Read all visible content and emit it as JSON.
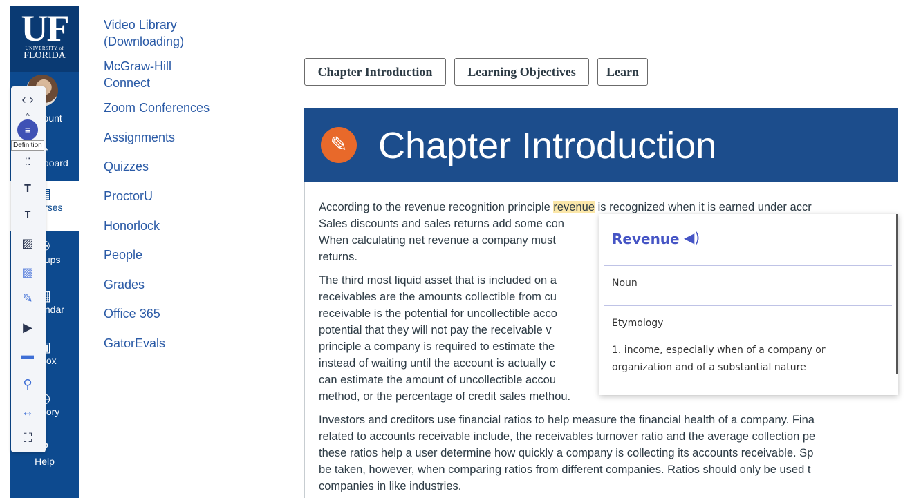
{
  "global_nav": {
    "logo": {
      "uf": "UF",
      "university": "UNIVERSITY of",
      "florida": "FLORIDA"
    },
    "items": [
      {
        "label": "Account",
        "icon": "avatar"
      },
      {
        "label": "Dashboard",
        "icon": "dashboard-icon"
      },
      {
        "label": "Courses",
        "icon": "courses-icon"
      },
      {
        "label": "Groups",
        "icon": "groups-icon"
      },
      {
        "label": "Calendar",
        "icon": "calendar-icon"
      },
      {
        "label": "Inbox",
        "icon": "inbox-icon"
      },
      {
        "label": "History",
        "icon": "history-icon"
      },
      {
        "label": "Help",
        "icon": "help-icon"
      }
    ]
  },
  "course_nav": {
    "items": [
      "Video Library (Downloading)",
      "McGraw-Hill Connect",
      "Zoom Conferences",
      "Assignments",
      "Quizzes",
      "ProctorU",
      "Honorlock",
      "People",
      "Grades",
      "Office 365",
      "GatorEvals"
    ]
  },
  "toolbar": {
    "tooltip": "Definition",
    "buttons": [
      "prev-next-icon",
      "collapse-icon",
      "definition-icon",
      "toggle-icon",
      "text-size-icon",
      "text-small-icon",
      "clipboard-icon",
      "image-icon",
      "edit-icon",
      "play-icon",
      "mask-icon",
      "search-icon",
      "spacing-icon",
      "fullscreen-icon"
    ]
  },
  "tabs": [
    {
      "label": "Chapter Introduction"
    },
    {
      "label": "Learning Objectives"
    },
    {
      "label": "Learn"
    }
  ],
  "banner": {
    "title": "Chapter Introduction",
    "icon": "tag-icon"
  },
  "content": {
    "p1": [
      {
        "before": "According to the revenue recognition principle ",
        "highlight": "revenue",
        "after": " is recognized when it is earned under accr"
      },
      "Sales discounts and sales returns add some con",
      "When calculating net revenue a company must",
      "returns."
    ],
    "p2": [
      "The third most liquid asset that is included on a",
      "receivables are the amounts collectible from cu",
      "receivable is the potential for uncollectible acco",
      "potential that they will not pay the receivable v",
      "principle a company is required to estimate the",
      "instead of waiting until the account is actually c",
      "can estimate the amount of uncollectible accou",
      "method, or the percentage of credit sales methou."
    ],
    "p3": [
      "Investors and creditors use financial ratios to help measure the financial health of a company. Fina",
      "related to accounts receivable include, the receivables turnover ratio and the average collection pe",
      "these ratios help a user determine how quickly a company is collecting its accounts receivable.  Sp",
      "be taken, however, when comparing ratios from different companies. Ratios should only be used t",
      "companies in like industries."
    ]
  },
  "definition_popup": {
    "word": "Revenue",
    "part_of_speech": "Noun",
    "etymology_label": "Etymology",
    "definition": "1. income, especially when of a company or organization and of a substantial nature"
  },
  "colors": {
    "nav_blue": "#0d4a8f",
    "banner_blue": "#1c4d8c",
    "link_blue": "#2a5aa6",
    "popup_accent": "#4655c5",
    "highlight": "#fbe7a9",
    "banner_icon": "#e8692a"
  }
}
